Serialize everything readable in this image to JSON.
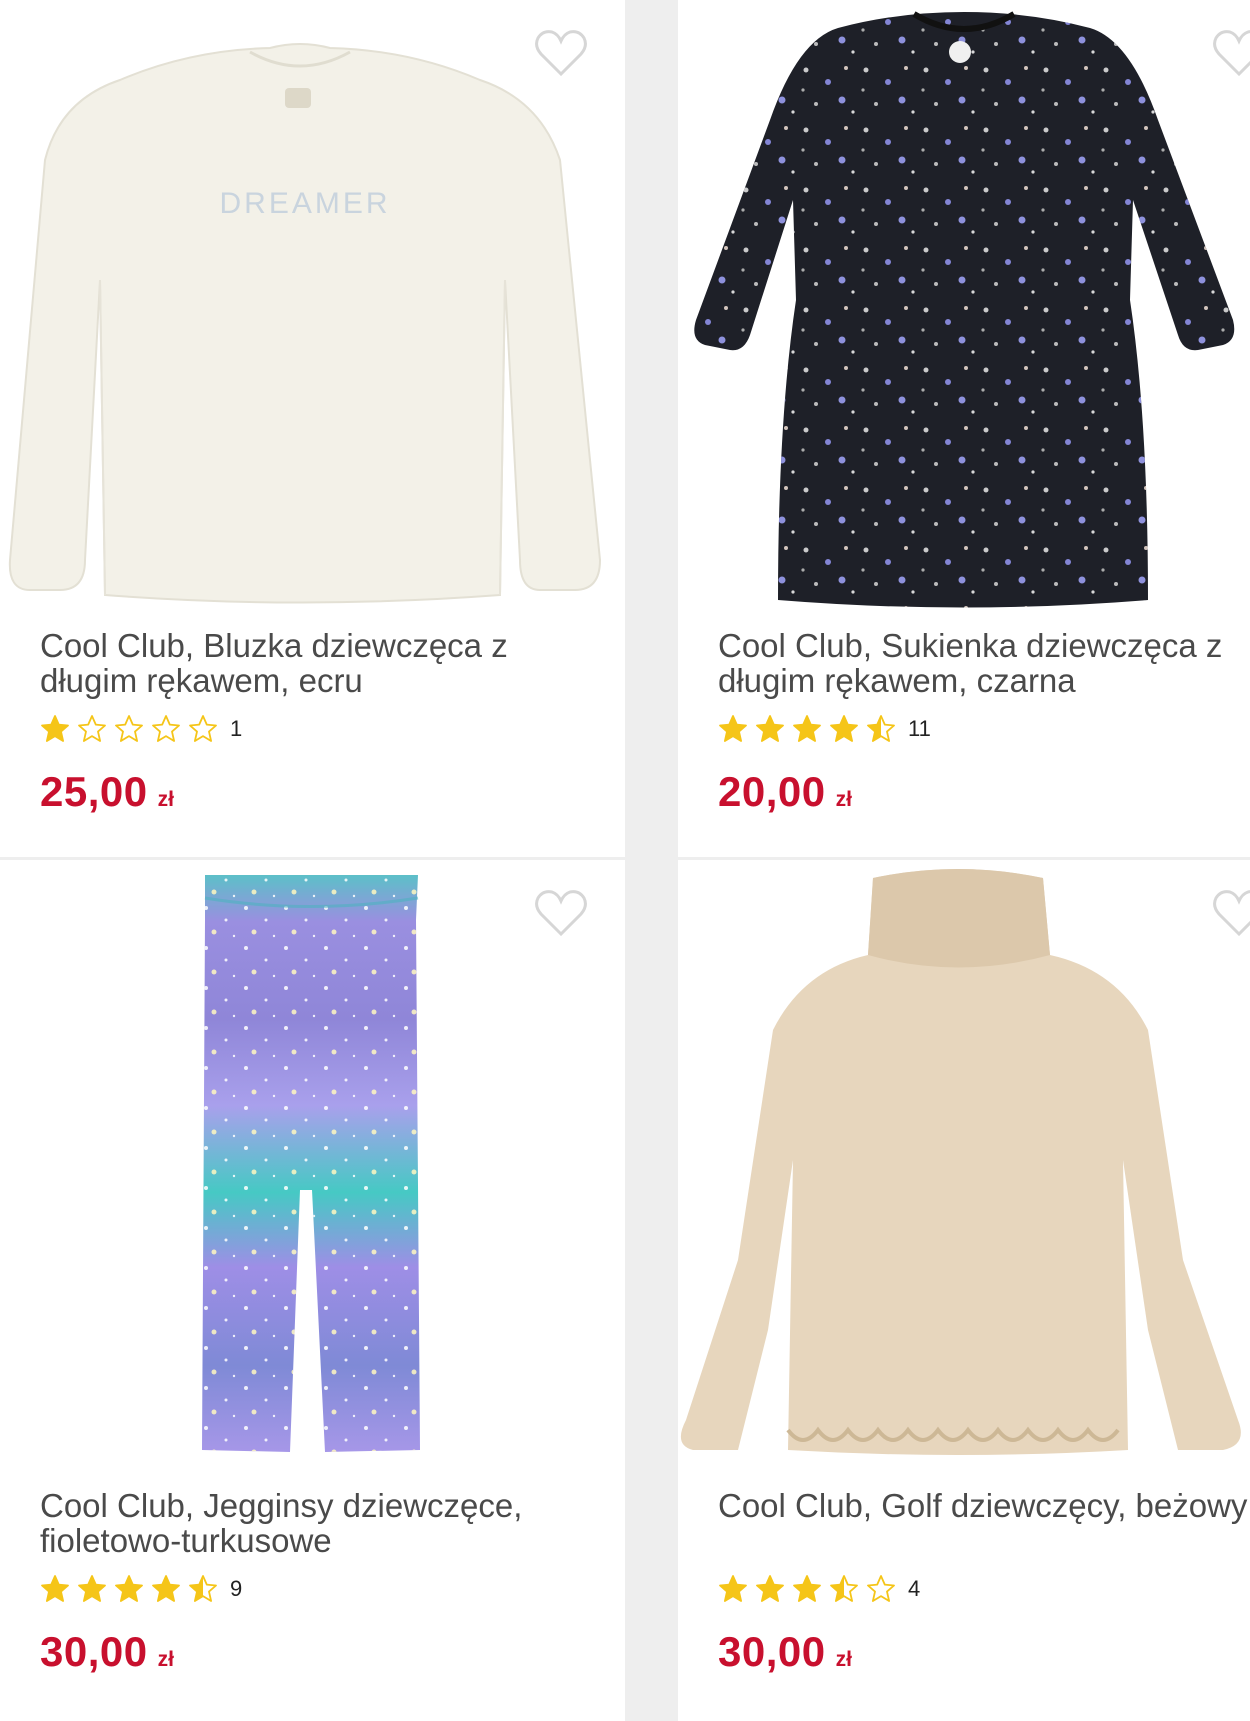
{
  "products": [
    {
      "title": "Cool Club, Bluzka dziewczęca z długim rękawem, ecru",
      "rating": 1,
      "reviews": "1",
      "price": "25,00",
      "currency": "zł",
      "image": "cream-sweatshirt",
      "print_text": "DREAMER"
    },
    {
      "title": "Cool Club, Sukienka dziewczęca z długim rękawem, czarna",
      "rating": 4.5,
      "reviews": "11",
      "price": "20,00",
      "currency": "zł",
      "image": "black-star-dress"
    },
    {
      "title": "Cool Club, Jegginsy dziewczęce, fioletowo-turkusowe",
      "rating": 4.5,
      "reviews": "9",
      "price": "30,00",
      "currency": "zł",
      "image": "purple-turquoise-leggings"
    },
    {
      "title": "Cool Club, Golf dziewczęcy, beżowy",
      "rating": 3.5,
      "reviews": "4",
      "price": "30,00",
      "currency": "zł",
      "image": "beige-turtleneck"
    }
  ],
  "colors": {
    "price": "#c8102e",
    "star": "#f5c518",
    "title": "#4a4a4a",
    "heart": "#d6d6d6"
  },
  "icons": {
    "favorite": "heart-outline-icon",
    "rating": "star-icon"
  }
}
